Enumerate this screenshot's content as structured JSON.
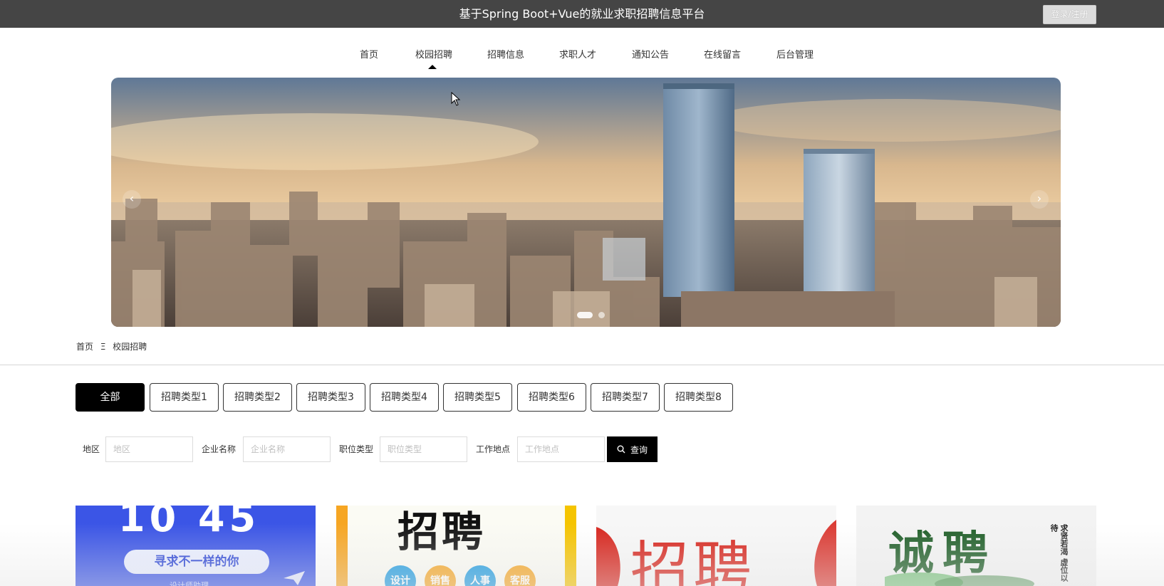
{
  "header": {
    "site_title": "基于Spring Boot+Vue的就业求职招聘信息平台",
    "login_label": "登录/注册"
  },
  "nav": {
    "items": [
      "首页",
      "校园招聘",
      "招聘信息",
      "求职人才",
      "通知公告",
      "在线留言",
      "后台管理"
    ],
    "active": "校园招聘"
  },
  "banner": {
    "slide_count": 2,
    "active_slide": 1,
    "prev_icon": "chevron-left-icon",
    "next_icon": "chevron-right-icon"
  },
  "breadcrumb": {
    "home": "首页",
    "separator": "Ξ",
    "current": "校园招聘"
  },
  "categories": {
    "items": [
      "全部",
      "招聘类型1",
      "招聘类型2",
      "招聘类型3",
      "招聘类型4",
      "招聘类型5",
      "招聘类型6",
      "招聘类型7",
      "招聘类型8"
    ],
    "active": "全部"
  },
  "filters": {
    "region": {
      "label": "地区",
      "placeholder": "地区"
    },
    "company": {
      "label": "企业名称",
      "placeholder": "企业名称"
    },
    "job_type": {
      "label": "职位类型",
      "placeholder": "职位类型"
    },
    "location": {
      "label": "工作地点",
      "placeholder": "工作地点"
    },
    "search_label": "查询",
    "search_icon": "search-icon"
  },
  "cards": {
    "card1": {
      "headline": "10 45",
      "tagline": "寻求不一样的你",
      "sub": "设计师助理"
    },
    "card2": {
      "headline": "招聘",
      "tags": [
        "设计",
        "销售",
        "人事",
        "客服"
      ]
    },
    "card3": {
      "headline": "招聘"
    },
    "card4": {
      "headline": "诚聘",
      "slogan": "求贤若渴 虚位以待"
    }
  },
  "colors": {
    "topbar": "#454545",
    "active_category": "#000000",
    "card1_bg": "#3b55e6",
    "card2_accent": "#f6a623",
    "card3_accent": "#d7261e",
    "card4_accent": "#2e7d32"
  }
}
